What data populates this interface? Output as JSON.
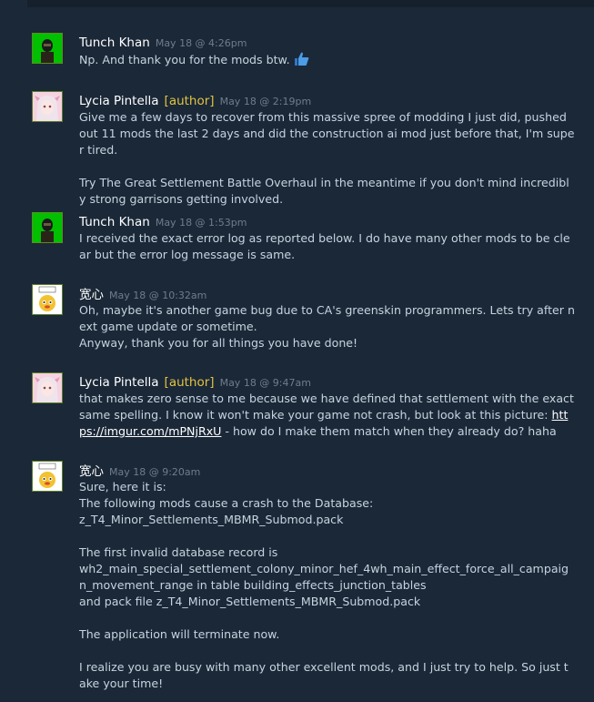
{
  "comments": [
    {
      "author": "Tunch Khan",
      "tag": "",
      "time": "May 18 @ 4:26pm",
      "text": "Np. And thank you for the mods btw.",
      "avatar_icon": "soldier-avatar-icon"
    },
    {
      "author": "Lycia Pintella",
      "tag": "[author]",
      "time": "May 18 @ 2:19pm",
      "text": "Give me a few days to recover from this massive spree of modding I just did, pushed out 11 mods the last 2 days and did the construction ai mod just before that, I'm super tired.\n\nTry The Great Settlement Battle Overhaul in the meantime if you don't mind incredibly strong garrisons getting involved.",
      "avatar_icon": "anime-girl-avatar-icon"
    },
    {
      "author": "Tunch Khan",
      "tag": "",
      "time": "May 18 @ 1:53pm",
      "text": "I received the exact error log as reported below. I do have many other mods to be clear but the error log message is same.",
      "avatar_icon": "soldier-avatar-icon"
    },
    {
      "author": "宽心",
      "tag": "",
      "time": "May 18 @ 10:32am",
      "text": "Oh, maybe it's another game bug due to CA's greenskin programmers. Lets try after next game update or sometime.\nAnyway, thank you for all things you have done!",
      "avatar_icon": "cartoon-face-avatar-icon"
    },
    {
      "author": "Lycia Pintella",
      "tag": "[author]",
      "time": "May 18 @ 9:47am",
      "text_before": "that makes zero sense to me because we have defined that settlement with the exact same spelling. I know it won't make your game not crash, but look at this picture: ",
      "link": "https://imgur.com/mPNjRxU",
      "text_after": " - how do I make them match when they already do? haha",
      "avatar_icon": "anime-girl-avatar-icon"
    },
    {
      "author": "宽心",
      "tag": "",
      "time": "May 18 @ 9:20am",
      "text": "Sure, here it is:\nThe following mods cause a crash to the Database:\nz_T4_Minor_Settlements_MBMR_Submod.pack\n\nThe first invalid database record is\nwh2_main_special_settlement_colony_minor_hef_4wh_main_effect_force_all_campaign_movement_range in table building_effects_junction_tables\nand pack file z_T4_Minor_Settlements_MBMR_Submod.pack\n\nThe application will terminate now.\n\nI realize you are busy with many other excellent mods, and I just try to help. So just take your time!",
      "avatar_icon": "cartoon-face-avatar-icon"
    }
  ],
  "emoji": "thumbs-up-icon",
  "colors": {
    "background": "#1b2838",
    "author": "#ffffff",
    "tag": "#e1c441",
    "time": "#6f7d8a",
    "text": "#c6d4df"
  }
}
